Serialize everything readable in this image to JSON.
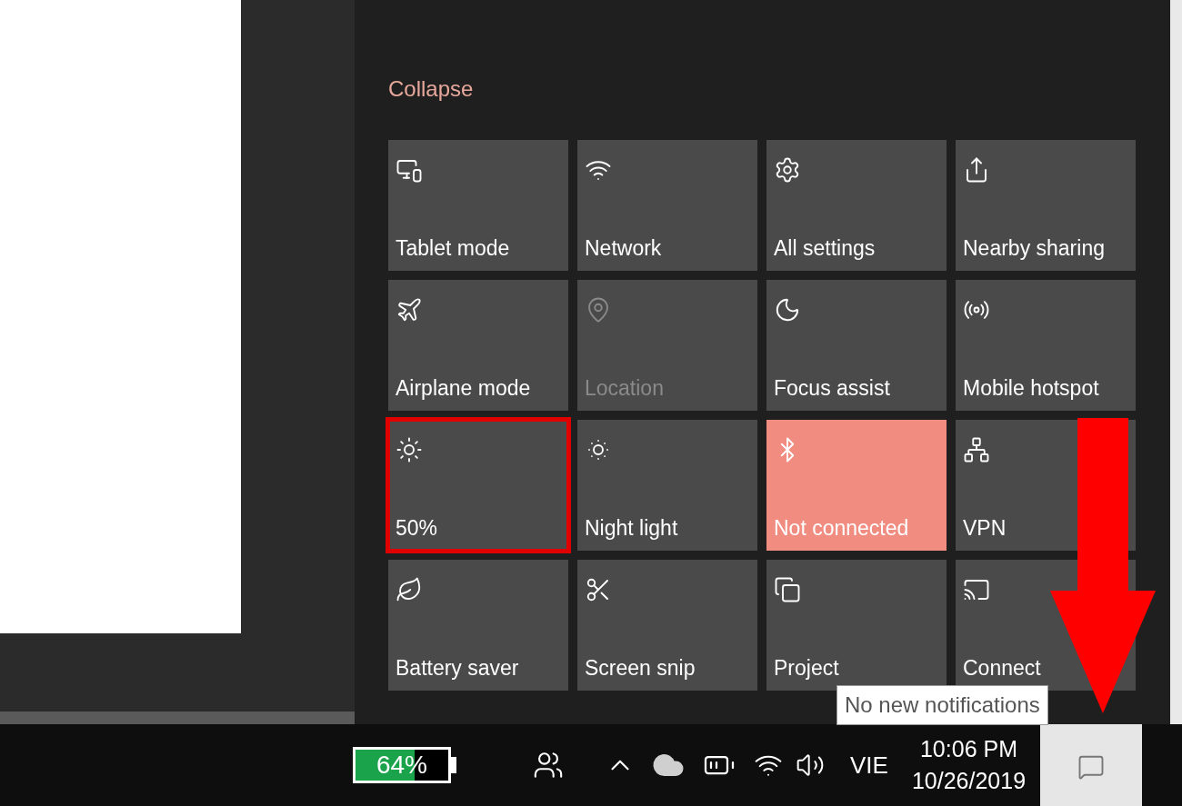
{
  "action_center": {
    "collapse_link": "Collapse",
    "tiles": [
      {
        "label": "Tablet mode",
        "on": false,
        "disabled": false,
        "annotated": false
      },
      {
        "label": "Network",
        "on": false,
        "disabled": false,
        "annotated": false
      },
      {
        "label": "All settings",
        "on": false,
        "disabled": false,
        "annotated": false
      },
      {
        "label": "Nearby sharing",
        "on": false,
        "disabled": false,
        "annotated": false
      },
      {
        "label": "Airplane mode",
        "on": false,
        "disabled": false,
        "annotated": false
      },
      {
        "label": "Location",
        "on": false,
        "disabled": true,
        "annotated": false
      },
      {
        "label": "Focus assist",
        "on": false,
        "disabled": false,
        "annotated": false
      },
      {
        "label": "Mobile hotspot",
        "on": false,
        "disabled": false,
        "annotated": false
      },
      {
        "label": "50%",
        "on": false,
        "disabled": false,
        "annotated": true
      },
      {
        "label": "Night light",
        "on": false,
        "disabled": false,
        "annotated": false
      },
      {
        "label": "Not connected",
        "on": true,
        "disabled": false,
        "annotated": false
      },
      {
        "label": "VPN",
        "on": false,
        "disabled": false,
        "annotated": false
      },
      {
        "label": "Battery saver",
        "on": false,
        "disabled": false,
        "annotated": false
      },
      {
        "label": "Screen snip",
        "on": false,
        "disabled": false,
        "annotated": false
      },
      {
        "label": "Project",
        "on": false,
        "disabled": false,
        "annotated": false
      },
      {
        "label": "Connect",
        "on": false,
        "disabled": false,
        "annotated": false
      }
    ]
  },
  "tooltip": "No new notifications",
  "taskbar": {
    "battery_meter": {
      "reading": "64%",
      "level": 0.64
    },
    "language": "VIE",
    "time": "10:06 PM",
    "date": "10/26/2019"
  }
}
